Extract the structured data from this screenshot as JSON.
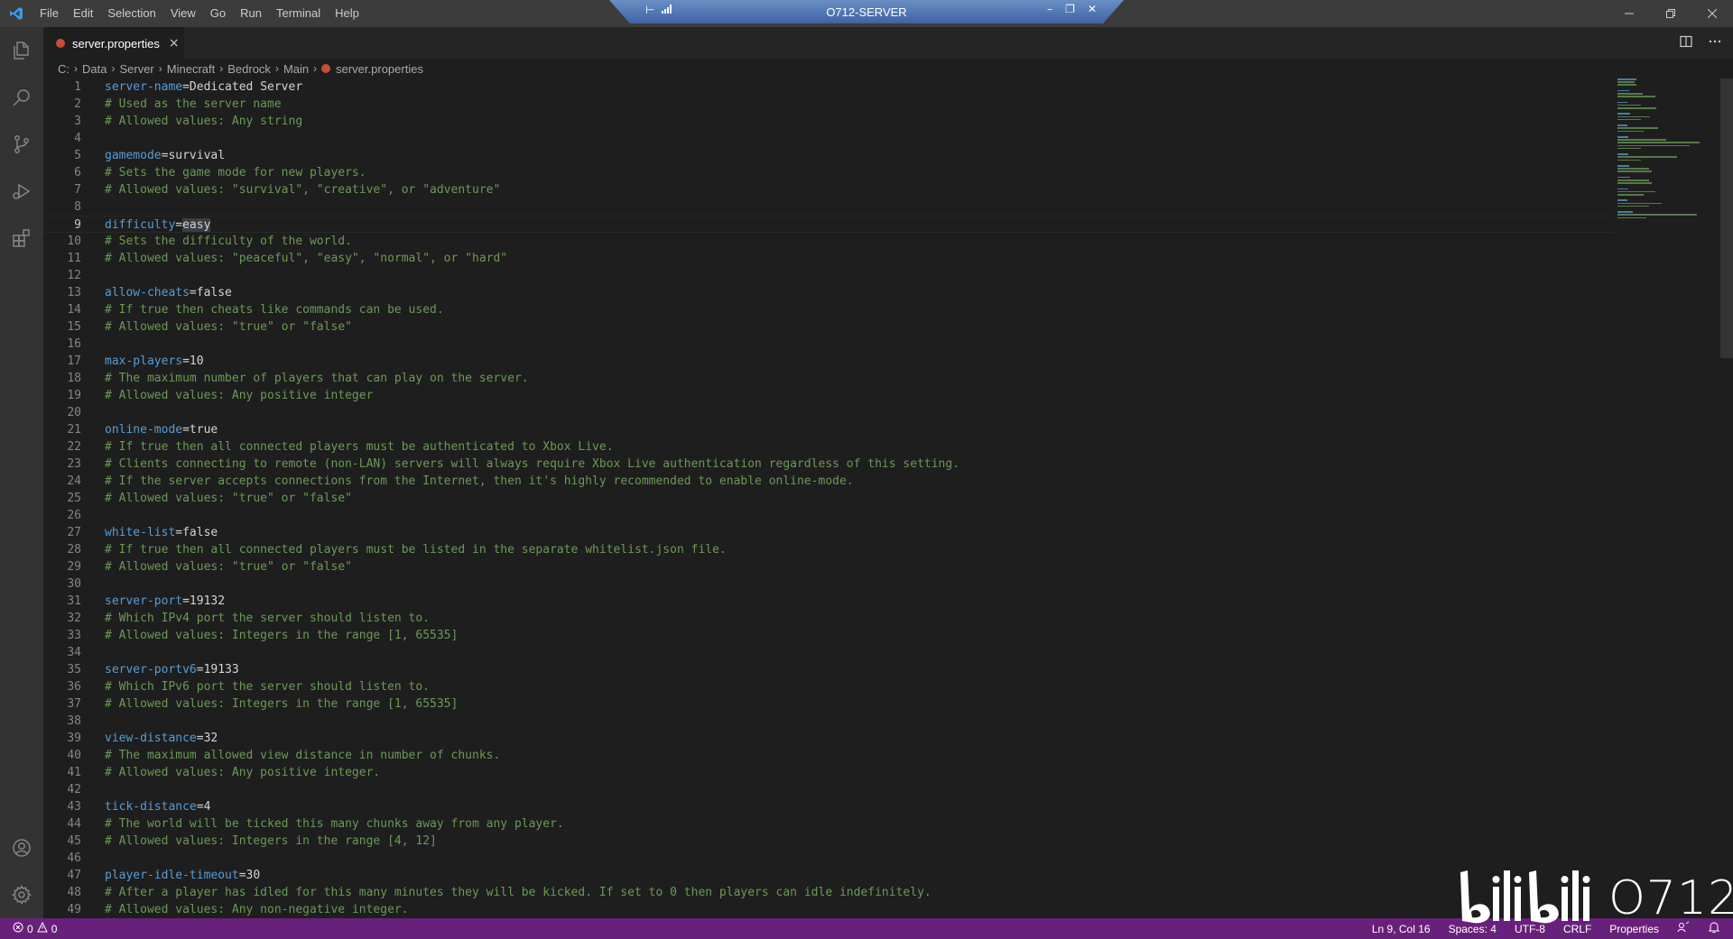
{
  "menu": [
    "File",
    "Edit",
    "Selection",
    "View",
    "Go",
    "Run",
    "Terminal",
    "Help"
  ],
  "remote": {
    "title": "O712-SERVER"
  },
  "tab": {
    "label": "server.properties",
    "close": "×"
  },
  "breadcrumb": [
    "C:",
    "Data",
    "Server",
    "Minecraft",
    "Bedrock",
    "Main",
    "server.properties"
  ],
  "editor": {
    "current_line": 9,
    "lines": [
      {
        "n": "1",
        "key": "server-name",
        "eq": "=",
        "value": "Dedicated Server"
      },
      {
        "n": "2",
        "comment": "# Used as the server name"
      },
      {
        "n": "3",
        "comment": "# Allowed values: Any string"
      },
      {
        "n": "4"
      },
      {
        "n": "5",
        "key": "gamemode",
        "eq": "=",
        "value": "survival"
      },
      {
        "n": "6",
        "comment": "# Sets the game mode for new players."
      },
      {
        "n": "7",
        "comment": "# Allowed values: \"survival\", \"creative\", or \"adventure\""
      },
      {
        "n": "8"
      },
      {
        "n": "9",
        "key": "difficulty",
        "eq": "=",
        "value": "easy"
      },
      {
        "n": "10",
        "comment": "# Sets the difficulty of the world."
      },
      {
        "n": "11",
        "comment": "# Allowed values: \"peaceful\", \"easy\", \"normal\", or \"hard\""
      },
      {
        "n": "12"
      },
      {
        "n": "13",
        "key": "allow-cheats",
        "eq": "=",
        "value": "false"
      },
      {
        "n": "14",
        "comment": "# If true then cheats like commands can be used."
      },
      {
        "n": "15",
        "comment": "# Allowed values: \"true\" or \"false\""
      },
      {
        "n": "16"
      },
      {
        "n": "17",
        "key": "max-players",
        "eq": "=",
        "value": "10"
      },
      {
        "n": "18",
        "comment": "# The maximum number of players that can play on the server."
      },
      {
        "n": "19",
        "comment": "# Allowed values: Any positive integer"
      },
      {
        "n": "20"
      },
      {
        "n": "21",
        "key": "online-mode",
        "eq": "=",
        "value": "true"
      },
      {
        "n": "22",
        "comment": "# If true then all connected players must be authenticated to Xbox Live."
      },
      {
        "n": "23",
        "comment": "# Clients connecting to remote (non-LAN) servers will always require Xbox Live authentication regardless of this setting."
      },
      {
        "n": "24",
        "comment": "# If the server accepts connections from the Internet, then it's highly recommended to enable online-mode."
      },
      {
        "n": "25",
        "comment": "# Allowed values: \"true\" or \"false\""
      },
      {
        "n": "26"
      },
      {
        "n": "27",
        "key": "white-list",
        "eq": "=",
        "value": "false"
      },
      {
        "n": "28",
        "comment": "# If true then all connected players must be listed in the separate whitelist.json file."
      },
      {
        "n": "29",
        "comment": "# Allowed values: \"true\" or \"false\""
      },
      {
        "n": "30"
      },
      {
        "n": "31",
        "key": "server-port",
        "eq": "=",
        "value": "19132"
      },
      {
        "n": "32",
        "comment": "# Which IPv4 port the server should listen to."
      },
      {
        "n": "33",
        "comment": "# Allowed values: Integers in the range [1, 65535]"
      },
      {
        "n": "34"
      },
      {
        "n": "35",
        "key": "server-portv6",
        "eq": "=",
        "value": "19133"
      },
      {
        "n": "36",
        "comment": "# Which IPv6 port the server should listen to."
      },
      {
        "n": "37",
        "comment": "# Allowed values: Integers in the range [1, 65535]"
      },
      {
        "n": "38"
      },
      {
        "n": "39",
        "key": "view-distance",
        "eq": "=",
        "value": "32"
      },
      {
        "n": "40",
        "comment": "# The maximum allowed view distance in number of chunks."
      },
      {
        "n": "41",
        "comment": "# Allowed values: Any positive integer."
      },
      {
        "n": "42"
      },
      {
        "n": "43",
        "key": "tick-distance",
        "eq": "=",
        "value": "4"
      },
      {
        "n": "44",
        "comment": "# The world will be ticked this many chunks away from any player."
      },
      {
        "n": "45",
        "comment": "# Allowed values: Integers in the range [4, 12]"
      },
      {
        "n": "46"
      },
      {
        "n": "47",
        "key": "player-idle-timeout",
        "eq": "=",
        "value": "30"
      },
      {
        "n": "48",
        "comment": "# After a player has idled for this many minutes they will be kicked. If set to 0 then players can idle indefinitely."
      },
      {
        "n": "49",
        "comment": "# Allowed values: Any non-negative integer."
      }
    ]
  },
  "status": {
    "errors": "0",
    "warnings": "0",
    "position": "Ln 9, Col 16",
    "spaces": "Spaces: 4",
    "encoding": "UTF-8",
    "eol": "CRLF",
    "language": "Properties"
  },
  "watermark": {
    "text": "O712"
  },
  "colors": {
    "statusbar": "#68217a",
    "key": "#569cd6",
    "comment": "#6a9955",
    "accent": "#3c78d8"
  }
}
